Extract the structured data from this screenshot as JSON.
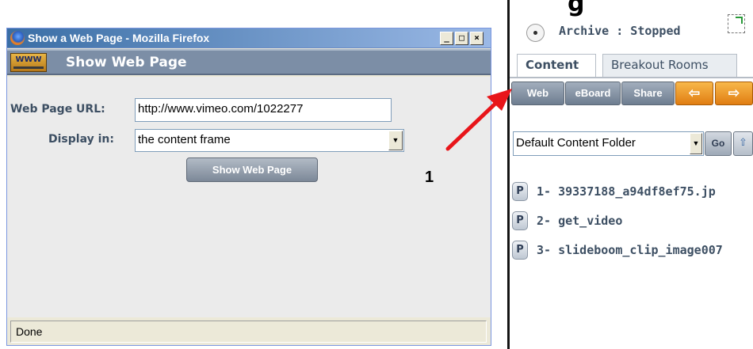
{
  "top_partial_text": "g",
  "firefox_window": {
    "title": "Show a Web Page - Mozilla Firefox",
    "controls": {
      "minimize": "_",
      "maximize": "□",
      "close": "×"
    },
    "header": {
      "icon_text": "WWW",
      "title": "Show Web Page"
    },
    "form": {
      "url_label": "Web Page URL:",
      "url_value": "http://www.vimeo.com/1022277",
      "display_label": "Display in:",
      "display_value": "the content frame",
      "submit_label": "Show Web Page"
    },
    "status_bar": "Done"
  },
  "right_panel": {
    "archive_status": "Archive : Stopped",
    "tabs": [
      {
        "label": "Content",
        "active": true
      },
      {
        "label": "Breakout Rooms",
        "active": false
      }
    ],
    "toolbar": {
      "web": "Web",
      "eboard": "eBoard",
      "share": "Share",
      "back_icon": "left-arrow-icon",
      "forward_icon": "right-arrow-icon"
    },
    "folder_select": "Default Content Folder",
    "go_label": "Go",
    "files": [
      {
        "badge": "P",
        "name": "1- 39337188_a94df8ef75.jp"
      },
      {
        "badge": "P",
        "name": "2- get_video"
      },
      {
        "badge": "P",
        "name": "3- slideboom_clip_image007"
      }
    ]
  },
  "annotation": {
    "number": "1",
    "arrow_color": "#e8151a"
  }
}
